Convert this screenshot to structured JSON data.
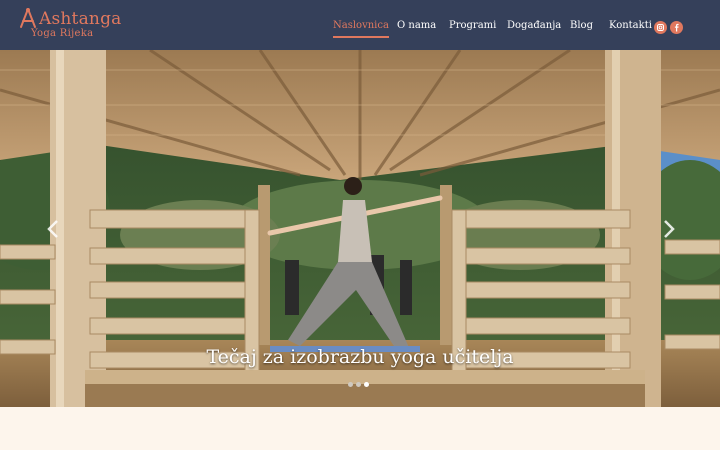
{
  "brand": {
    "name": "Ashtanga",
    "subtitle": "Yoga Rijeka",
    "accent_color": "#e0785e",
    "header_color": "#35405a"
  },
  "nav": {
    "items": [
      {
        "label": "Naslovnica",
        "active": true
      },
      {
        "label": "O nama",
        "active": false
      },
      {
        "label": "Programi",
        "active": false
      },
      {
        "label": "Događanja",
        "active": false
      },
      {
        "label": "Blog",
        "active": false
      },
      {
        "label": "Kontakti",
        "active": false
      }
    ],
    "social": [
      "instagram-icon",
      "facebook-icon"
    ]
  },
  "hero": {
    "caption": "Tečaj za izobrazbu yoga učitelja",
    "slides_count": 3,
    "active_slide": 3,
    "prev_icon": "chevron-left-icon",
    "next_icon": "chevron-right-icon"
  }
}
